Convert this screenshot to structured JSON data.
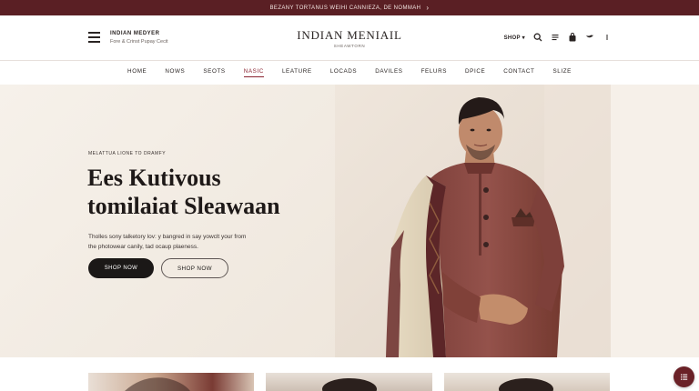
{
  "announcement": {
    "text": "BEZANY TORTANUS WEIHI   CANNIEZA, DE NOMMAH",
    "arrow": "›"
  },
  "header": {
    "brand_title": "INDIAN MEDYER",
    "brand_subtitle": "Fore & Crinst Pupay Cecit",
    "logo_main": "INDIAN MENIAIL",
    "logo_sub": "SHEAWTORN",
    "shop_label": "SHOP ▾",
    "icons": [
      "hamburger-icon",
      "search-icon",
      "list-icon",
      "bag-icon",
      "bird-icon",
      "more-icon"
    ]
  },
  "nav": {
    "items": [
      {
        "label": "HOME"
      },
      {
        "label": "NOWS"
      },
      {
        "label": "SEOTS"
      },
      {
        "label": "NASIC",
        "active": true
      },
      {
        "label": "LEATURE"
      },
      {
        "label": "LOCADS"
      },
      {
        "label": "DAVILES"
      },
      {
        "label": "FELURS"
      },
      {
        "label": "DPICE"
      },
      {
        "label": "CONTACT"
      },
      {
        "label": "SLIZE"
      }
    ]
  },
  "hero": {
    "eyebrow": "MELATTUA LIONE TO DRAMFY",
    "headline_line1": "Ees Kutivous",
    "headline_line2": "tomilaiat Sleawaan",
    "description_line1": "Tholles sony talketory lov: y bangred in say yowclt your from",
    "description_line2": "the photowear canily, tad ocaup plaeness.",
    "primary_button": "SHOP NOW",
    "secondary_button": "SHOP NOW"
  },
  "colors": {
    "announcement_bg": "#5a1f24",
    "accent": "#8a2330",
    "hero_bg": "#f3ede6",
    "kurta": "#8b4a44",
    "button_dark": "#1b1817",
    "chat_button": "#6a2127"
  }
}
